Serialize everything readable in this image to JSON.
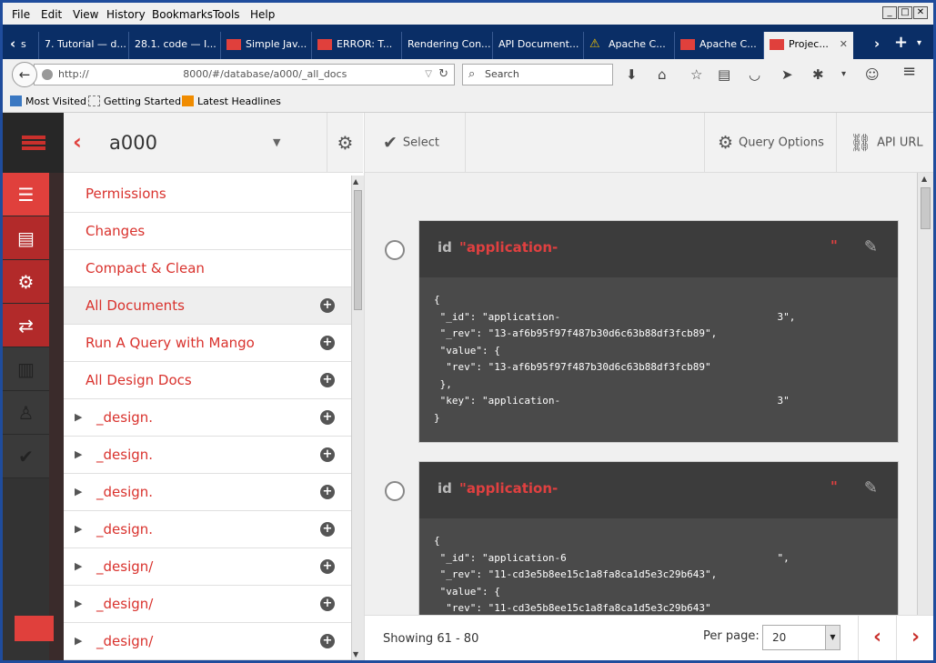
{
  "menubar": {
    "items": [
      "File",
      "Edit",
      "View",
      "History",
      "Bookmarks",
      "Tools",
      "Help"
    ]
  },
  "tabs": [
    {
      "label": "s",
      "icon": "none"
    },
    {
      "label": "7. Tutorial — d...",
      "icon": "none"
    },
    {
      "label": "28.1. code — I...",
      "icon": "none"
    },
    {
      "label": "Simple Jav...",
      "icon": "couchdb-icon"
    },
    {
      "label": "ERROR: T...",
      "icon": "couchdb-icon"
    },
    {
      "label": "Rendering Con...",
      "icon": "none"
    },
    {
      "label": "API Document...",
      "icon": "none"
    },
    {
      "label": "Apache C...",
      "icon": "warning-icon"
    },
    {
      "label": "Apache C...",
      "icon": "couchdb-icon"
    },
    {
      "label": "Projec...",
      "icon": "couchdb-icon",
      "active": true
    }
  ],
  "nav": {
    "url_prefix": "http://",
    "url_rest": "8000/#/database/a000/_all_docs",
    "search_placeholder": "Search"
  },
  "bookmarks": [
    "Most Visited",
    "Getting Started",
    "Latest Headlines"
  ],
  "app": {
    "db_name": "a000",
    "toolbar": {
      "select": "Select",
      "query_options": "Query Options",
      "api_url": "API URL"
    },
    "sidebar": [
      {
        "label": "Permissions",
        "plus": false,
        "active": false,
        "design": false
      },
      {
        "label": "Changes",
        "plus": false,
        "active": false,
        "design": false
      },
      {
        "label": "Compact & Clean",
        "plus": false,
        "active": false,
        "design": false
      },
      {
        "label": "All Documents",
        "plus": true,
        "active": true,
        "design": false
      },
      {
        "label": "Run A Query with Mango",
        "plus": true,
        "active": false,
        "design": false
      },
      {
        "label": "All Design Docs",
        "plus": true,
        "active": false,
        "design": false
      },
      {
        "label": "_design.",
        "plus": true,
        "active": false,
        "design": true
      },
      {
        "label": "_design.",
        "plus": true,
        "active": false,
        "design": true
      },
      {
        "label": "_design.",
        "plus": true,
        "active": false,
        "design": true
      },
      {
        "label": "_design.",
        "plus": true,
        "active": false,
        "design": true
      },
      {
        "label": "_design/",
        "plus": true,
        "active": false,
        "design": true
      },
      {
        "label": "_design/",
        "plus": true,
        "active": false,
        "design": true
      },
      {
        "label": "_design/",
        "plus": true,
        "active": false,
        "design": true
      }
    ],
    "docs": [
      {
        "id_label": "id",
        "id_value": "\"application-",
        "id_close": "\"",
        "lines": [
          "{",
          " \"_id\": \"application-                                    3\",",
          " \"_rev\": \"13-af6b95f97f487b30d6c63b88df3fcb89\",",
          " \"value\": {",
          "  \"rev\": \"13-af6b95f97f487b30d6c63b88df3fcb89\"",
          " },",
          " \"key\": \"application-                                    3\"",
          "}"
        ]
      },
      {
        "id_label": "id",
        "id_value": "\"application-",
        "id_close": "\"",
        "lines": [
          "{",
          " \"_id\": \"application-6                                   \",",
          " \"_rev\": \"11-cd3e5b8ee15c1a8fa8ca1d5e3c29b643\",",
          " \"value\": {",
          "  \"rev\": \"11-cd3e5b8ee15c1a8fa8ca1d5e3c29b643\""
        ]
      }
    ],
    "footer": {
      "showing": "Showing 61 - 80",
      "per_page_label": "Per page:",
      "per_page_value": "20"
    }
  }
}
